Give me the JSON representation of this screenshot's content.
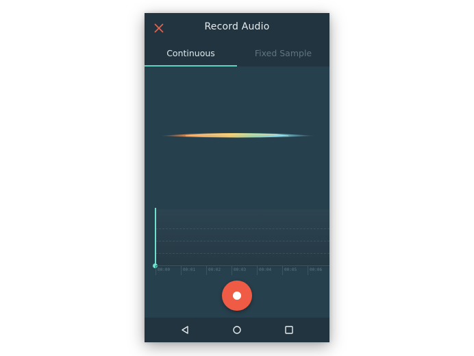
{
  "app_bar": {
    "title": "Record Audio",
    "close_icon": "close-icon"
  },
  "tabs": [
    {
      "label": "Continuous",
      "active": true
    },
    {
      "label": "Fixed Sample",
      "active": false
    }
  ],
  "timeline": {
    "ticks": [
      "00:00",
      "00:01",
      "00:02",
      "00:03",
      "00:04",
      "00:05",
      "00:06"
    ]
  },
  "record_button": {
    "icon": "record-icon"
  },
  "nav": {
    "back_icon": "back-triangle-icon",
    "home_icon": "home-circle-icon",
    "recents_icon": "recents-square-icon"
  },
  "colors": {
    "background": "#27404d",
    "app_bar": "#22343f",
    "accent": "#5fd3c0",
    "record": "#f05b45"
  }
}
